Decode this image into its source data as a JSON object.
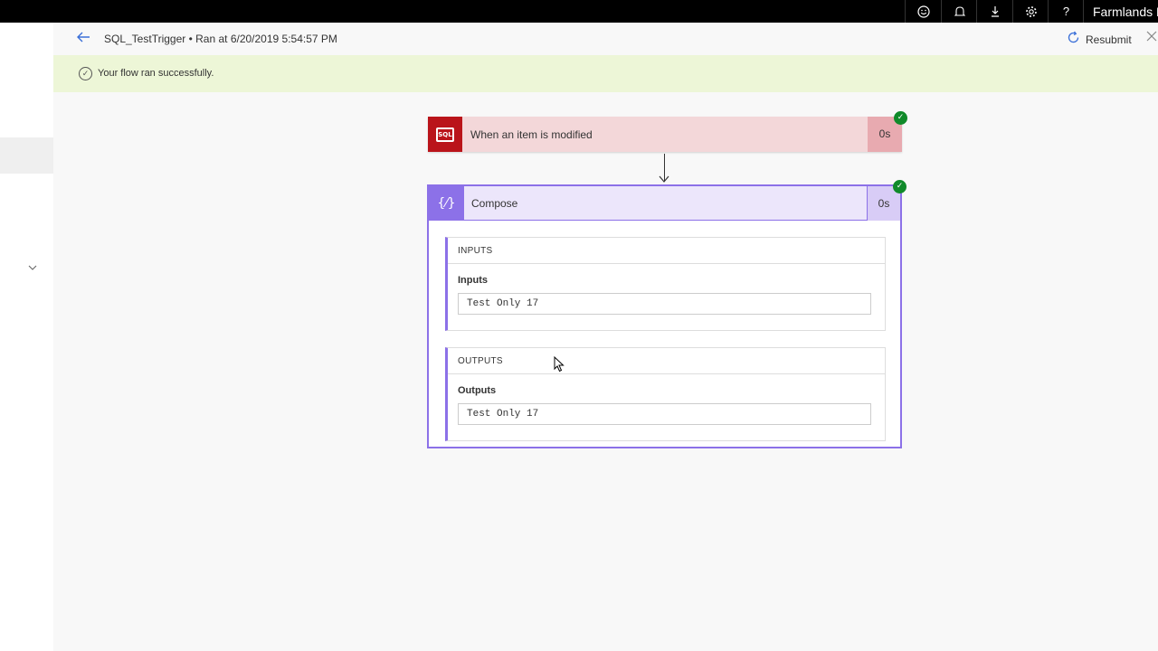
{
  "topbar": {
    "icons": [
      "smiley-icon",
      "bell-icon",
      "download-icon",
      "gear-icon",
      "help-icon"
    ],
    "org_name": "Farmlands Po"
  },
  "header": {
    "back_icon": "arrow-left-icon",
    "title": "SQL_TestTrigger • Ran at 6/20/2019 5:54:57 PM",
    "resubmit_label": "Resubmit",
    "close_icon": "close-icon"
  },
  "banner": {
    "message": "Your flow ran successfully.",
    "color": "#edf6d7"
  },
  "trigger": {
    "label": "When an item is modified",
    "duration": "0s",
    "icon": "sql-server-icon",
    "color": "#ba141a"
  },
  "compose": {
    "label": "Compose",
    "duration": "0s",
    "icon": "braces-icon",
    "color": "#8c71e8",
    "inputs": {
      "header": "INPUTS",
      "field_label": "Inputs",
      "field_value": "Test Only 17"
    },
    "outputs": {
      "header": "OUTPUTS",
      "field_label": "Outputs",
      "field_value": "Test Only 17"
    }
  },
  "status": {
    "success_color": "#108a2a"
  }
}
